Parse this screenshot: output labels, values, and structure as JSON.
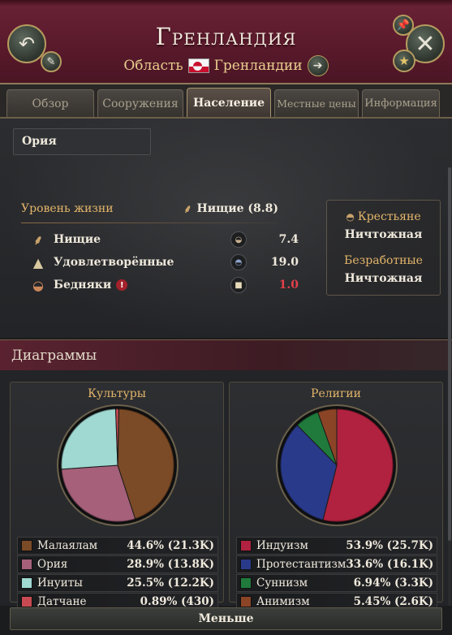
{
  "header": {
    "title": "Гренландия",
    "subtitle_prefix": "Область",
    "subtitle_name": "Гренландии"
  },
  "tabs": [
    {
      "label": "Обзор",
      "active": false
    },
    {
      "label": "Сооружения",
      "active": false
    },
    {
      "label": "Население",
      "active": true
    },
    {
      "label": "Местные цены",
      "active": false
    },
    {
      "label": "Информация",
      "active": false
    }
  ],
  "population": {
    "selected_culture": "Ория",
    "standard_of_living": {
      "label": "Уровень жизни",
      "value": "Нищие (8.8)"
    },
    "strata": [
      {
        "label": "Нищие",
        "value": "7.4",
        "warning": false,
        "icon": "wheat-icon",
        "value_icon": "bread-icon"
      },
      {
        "label": "Удовлетворённые",
        "value": "19.0",
        "warning": false,
        "icon": "hat-icon",
        "value_icon": "bowl-icon"
      },
      {
        "label": "Бедняки",
        "value": "1.0",
        "warning": true,
        "warning_mark": "!",
        "icon": "bowl-icon",
        "value_icon": "cup-icon"
      }
    ],
    "side": {
      "peasants_label": "Крестьяне",
      "peasants_value": "Ничтожная",
      "unemployed_label": "Безработные",
      "unemployed_value": "Ничтожная"
    }
  },
  "diagrams": {
    "header": "Диаграммы",
    "less_button": "Меньше"
  },
  "chart_data": [
    {
      "type": "pie",
      "title": "Культуры",
      "slices": [
        {
          "name": "Малаялам",
          "value": 44.6,
          "label": "44.6% (21.3K)",
          "color": "#7b4a26"
        },
        {
          "name": "Ория",
          "value": 28.9,
          "label": "28.9% (13.8K)",
          "color": "#a6607a"
        },
        {
          "name": "Инуиты",
          "value": 25.5,
          "label": "25.5% (12.2K)",
          "color": "#9fd9d2"
        },
        {
          "name": "Датчане",
          "value": 0.89,
          "label": "0.89% (430)",
          "color": "#c94a52"
        }
      ]
    },
    {
      "type": "pie",
      "title": "Религии",
      "slices": [
        {
          "name": "Индуизм",
          "value": 53.9,
          "label": "53.9% (25.7K)",
          "color": "#b0223f"
        },
        {
          "name": "Протестантизм",
          "value": 33.6,
          "label": "33.6% (16.1K)",
          "color": "#2a3a8a"
        },
        {
          "name": "Суннизм",
          "value": 6.94,
          "label": "6.94% (3.3K)",
          "color": "#1f7a3c"
        },
        {
          "name": "Анимизм",
          "value": 5.45,
          "label": "5.45% (2.6K)",
          "color": "#8b4526"
        }
      ]
    }
  ]
}
